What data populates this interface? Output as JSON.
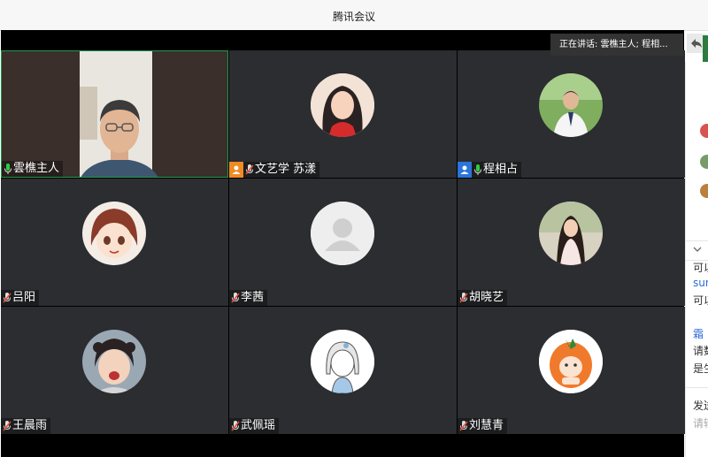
{
  "window": {
    "title": "腾讯会议"
  },
  "speaking": {
    "label": "正在讲话: 雲樵主人; 程相..."
  },
  "participants": [
    {
      "name": "雲樵主人",
      "mic": "on",
      "role": "",
      "video": true
    },
    {
      "name": "文艺学 苏漾",
      "mic": "muted",
      "role": "host",
      "video": false
    },
    {
      "name": "程相占",
      "mic": "on",
      "role": "cohost",
      "video": false
    },
    {
      "name": "吕阳",
      "mic": "muted",
      "role": "",
      "video": false
    },
    {
      "name": "李茜",
      "mic": "muted",
      "role": "",
      "video": false
    },
    {
      "name": "胡晓艺",
      "mic": "muted",
      "role": "",
      "video": false
    },
    {
      "name": "王晨雨",
      "mic": "muted",
      "role": "",
      "video": false
    },
    {
      "name": "武佩瑶",
      "mic": "muted",
      "role": "",
      "video": false
    },
    {
      "name": "刘慧青",
      "mic": "muted",
      "role": "",
      "video": false
    }
  ],
  "chat": {
    "lines": [
      "可以",
      "sun",
      "可以",
      "霜",
      "请数",
      "是生",
      "发送",
      "请输"
    ]
  },
  "colors": {
    "tile_bg": "#2b2d31",
    "host_badge": "#f08a24",
    "cohost_badge": "#2b74d9",
    "mic_on": "#2ecc40",
    "mic_muted": "#e74c3c"
  }
}
